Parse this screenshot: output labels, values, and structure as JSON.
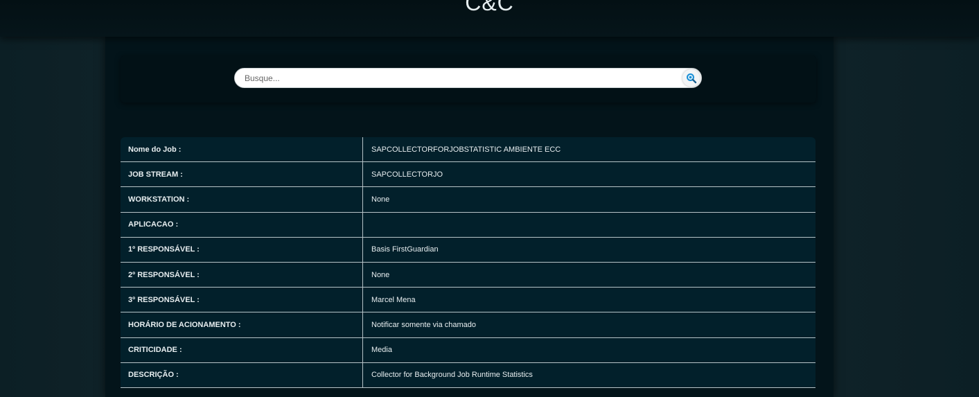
{
  "header": {
    "title": "C&C"
  },
  "search": {
    "placeholder": "Busque..."
  },
  "job_details": {
    "rows": [
      {
        "label": "Nome do Job :",
        "value": "SAPCOLLECTORFORJOBSTATISTIC AMBIENTE ECC"
      },
      {
        "label": "JOB STREAM :",
        "value": "SAPCOLLECTORJO"
      },
      {
        "label": "WORKSTATION :",
        "value": "None"
      },
      {
        "label": "APLICACAO :",
        "value": ""
      },
      {
        "label": "1º RESPONSÁVEL :",
        "value": "Basis FirstGuardian"
      },
      {
        "label": "2º RESPONSÁVEL :",
        "value": "None"
      },
      {
        "label": "3º RESPONSÁVEL :",
        "value": "Marcel Mena"
      },
      {
        "label": "HORÁRIO DE ACIONAMENTO :",
        "value": "Notificar somente via chamado"
      },
      {
        "label": "CRITICIDADE :",
        "value": "Media"
      },
      {
        "label": "DESCRIÇÃO :",
        "value": "Collector for Background Job Runtime Statistics"
      }
    ]
  },
  "icons": {
    "search": "search-magnifier-icon"
  },
  "colors": {
    "accent": "#1a8fd6",
    "table_bg": "#02202b",
    "panel_bg": "#03141a"
  }
}
